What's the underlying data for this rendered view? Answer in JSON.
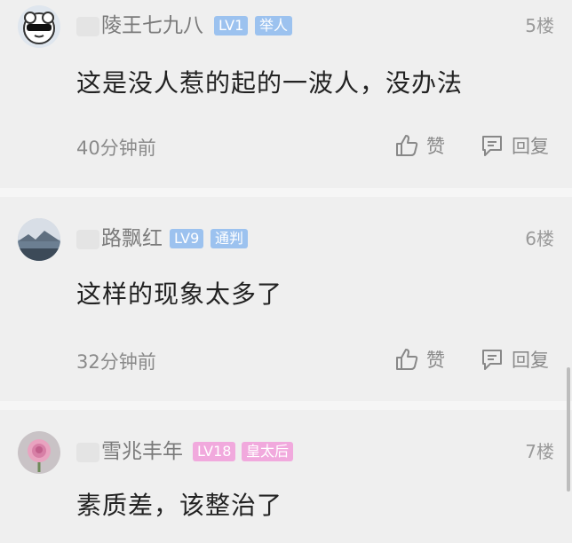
{
  "comments": [
    {
      "username": "陵王七九八",
      "level": "LV1",
      "title": "举人",
      "floor": "5楼",
      "text": "这是没人惹的起的一波人，没办法",
      "time": "40分钟前",
      "like_label": "赞",
      "reply_label": "回复",
      "avatar_icon": "cartoon-sunglasses-avatar"
    },
    {
      "username": "路飘红",
      "level": "LV9",
      "title": "通判",
      "floor": "6楼",
      "text": "这样的现象太多了",
      "time": "32分钟前",
      "like_label": "赞",
      "reply_label": "回复",
      "avatar_icon": "landscape-photo-avatar"
    },
    {
      "username": "雪兆丰年",
      "level": "LV18",
      "title": "皇太后",
      "floor": "7楼",
      "text": "素质差，该整治了",
      "avatar_icon": "pink-rose-avatar"
    }
  ],
  "colors": {
    "badge_blue": "#9cc2ef",
    "badge_pink": "#f1a9dd",
    "background": "#efefef",
    "secondary_text": "#8a8a8a"
  }
}
